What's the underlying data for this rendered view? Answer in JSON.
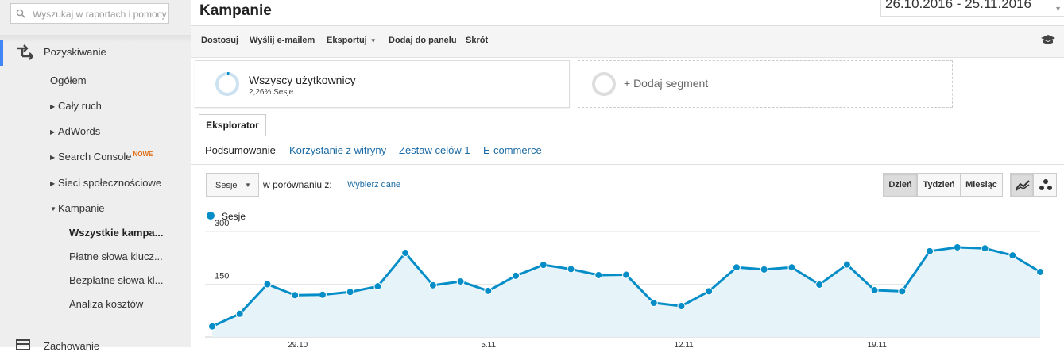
{
  "search": {
    "placeholder": "Wyszukaj w raportach i pomocy"
  },
  "sidebar": {
    "section": "Pozyskiwanie",
    "items": [
      {
        "label": "Ogółem",
        "type": "plain"
      },
      {
        "label": "Cały ruch",
        "type": "collapsed"
      },
      {
        "label": "AdWords",
        "type": "collapsed"
      },
      {
        "label": "Search Console",
        "type": "collapsed",
        "badge": "NOWE"
      },
      {
        "label": "Sieci społecznościowe",
        "type": "collapsed"
      },
      {
        "label": "Kampanie",
        "type": "expanded"
      }
    ],
    "subitems": [
      {
        "label": "Wszystkie kampa...",
        "active": true
      },
      {
        "label": "Płatne słowa klucz...",
        "active": false
      },
      {
        "label": "Bezpłatne słowa kl...",
        "active": false
      },
      {
        "label": "Analiza kosztów",
        "active": false
      }
    ],
    "next_section": "Zachowanie"
  },
  "header": {
    "title": "Kampanie",
    "date_range": "26.10.2016 - 25.11.2016"
  },
  "toolbar": {
    "customize": "Dostosuj",
    "email": "Wyślij e-mailem",
    "export": "Eksportuj",
    "add_dashboard": "Dodaj do panelu",
    "shortcut": "Skrót"
  },
  "segments": {
    "active": {
      "title": "Wszyscy użytkownicy",
      "subtitle": "2,26% Sesje"
    },
    "add": "+ Dodaj segment"
  },
  "tab": "Eksplorator",
  "subnav": [
    "Podsumowanie",
    "Korzystanie z witryny",
    "Zestaw celów 1",
    "E-commerce"
  ],
  "controls": {
    "metric": "Sesje",
    "compare_label": "w porównaniu z:",
    "compare_link": "Wybierz dane",
    "periods": [
      "Dzień",
      "Tydzień",
      "Miesiąc"
    ],
    "active_period": "Dzień"
  },
  "colors": {
    "series": "#058dc7",
    "area": "#e6f4fa",
    "accent": "#4285f4",
    "link": "#1a6aa5"
  },
  "chart_data": {
    "type": "area",
    "title": "",
    "legend": "top-left",
    "series": [
      {
        "name": "Sesje",
        "values": [
          30,
          66,
          150,
          119,
          120,
          128,
          144,
          239,
          147,
          158,
          131,
          174,
          205,
          193,
          176,
          177,
          97,
          88,
          130,
          198,
          192,
          198,
          149,
          206,
          133,
          130,
          244,
          255,
          252,
          232,
          185
        ]
      }
    ],
    "x_labels": [
      "29.10",
      "5.11",
      "12.11",
      "19.11"
    ],
    "y_ticks": [
      150,
      300
    ],
    "ylim": [
      0,
      300
    ],
    "grid": true
  }
}
